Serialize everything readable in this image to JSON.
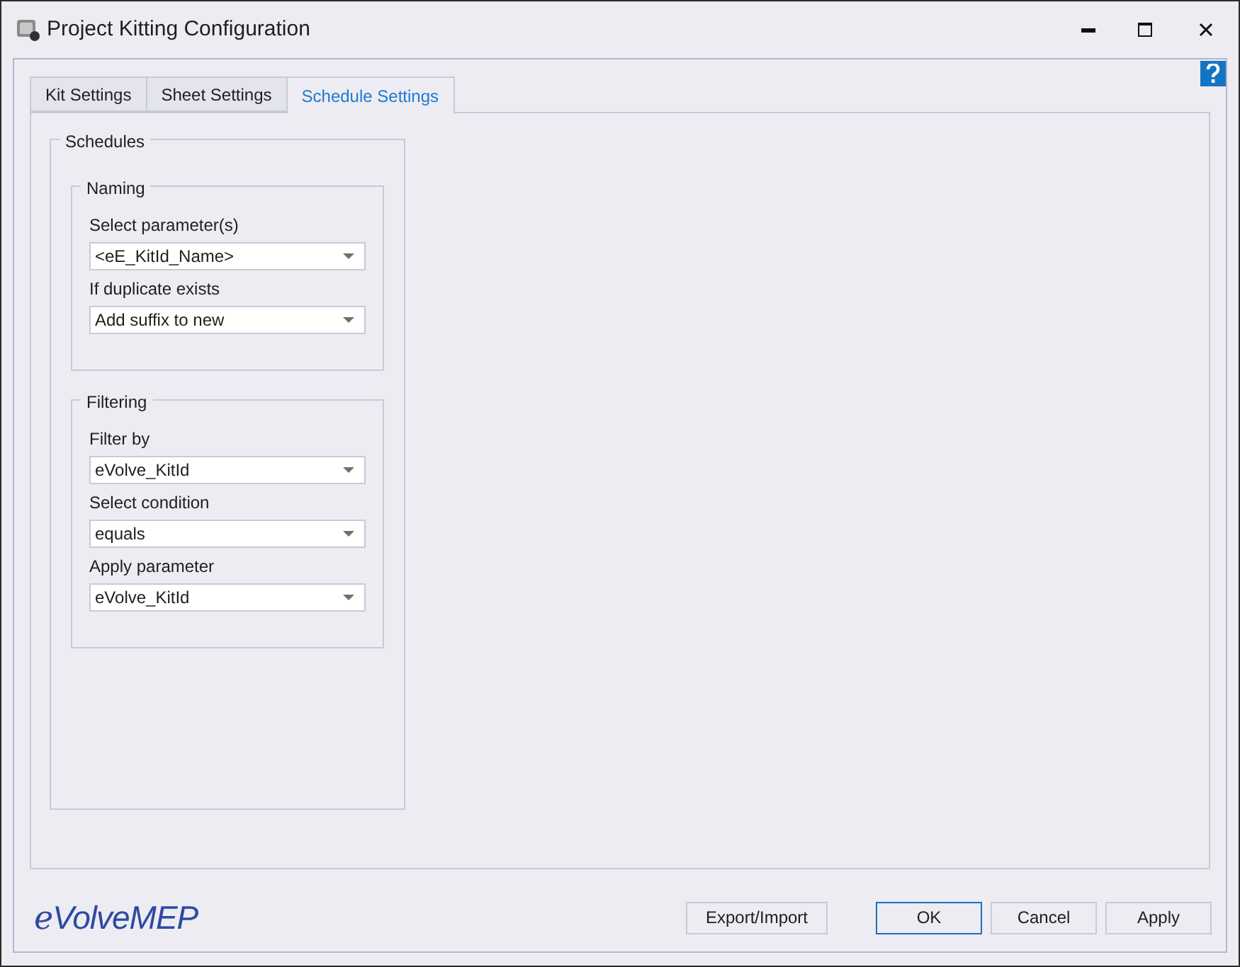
{
  "window": {
    "title": "Project Kitting Configuration"
  },
  "tabs": [
    {
      "label": "Kit Settings",
      "selected": false
    },
    {
      "label": "Sheet Settings",
      "selected": false
    },
    {
      "label": "Schedule Settings",
      "selected": true
    }
  ],
  "schedules": {
    "title": "Schedules",
    "groups": [
      {
        "title": "Naming",
        "fields": [
          {
            "label": "Select parameter(s)",
            "value": "<eE_KitId_Name>"
          },
          {
            "label": "If duplicate exists",
            "value": "Add suffix to new"
          }
        ]
      },
      {
        "title": "Filtering",
        "fields": [
          {
            "label": "Filter by",
            "value": "eVolve_KitId"
          },
          {
            "label": "Select condition",
            "value": "equals"
          },
          {
            "label": "Apply parameter",
            "value": "eVolve_KitId"
          }
        ]
      }
    ]
  },
  "logo": {
    "prefix": "e",
    "rest": "VolveMEP"
  },
  "buttons": [
    {
      "label": "Export/Import",
      "selected": false
    },
    {
      "label": "OK",
      "selected": true
    },
    {
      "label": "Cancel",
      "selected": false
    },
    {
      "label": "Apply",
      "selected": false
    }
  ]
}
